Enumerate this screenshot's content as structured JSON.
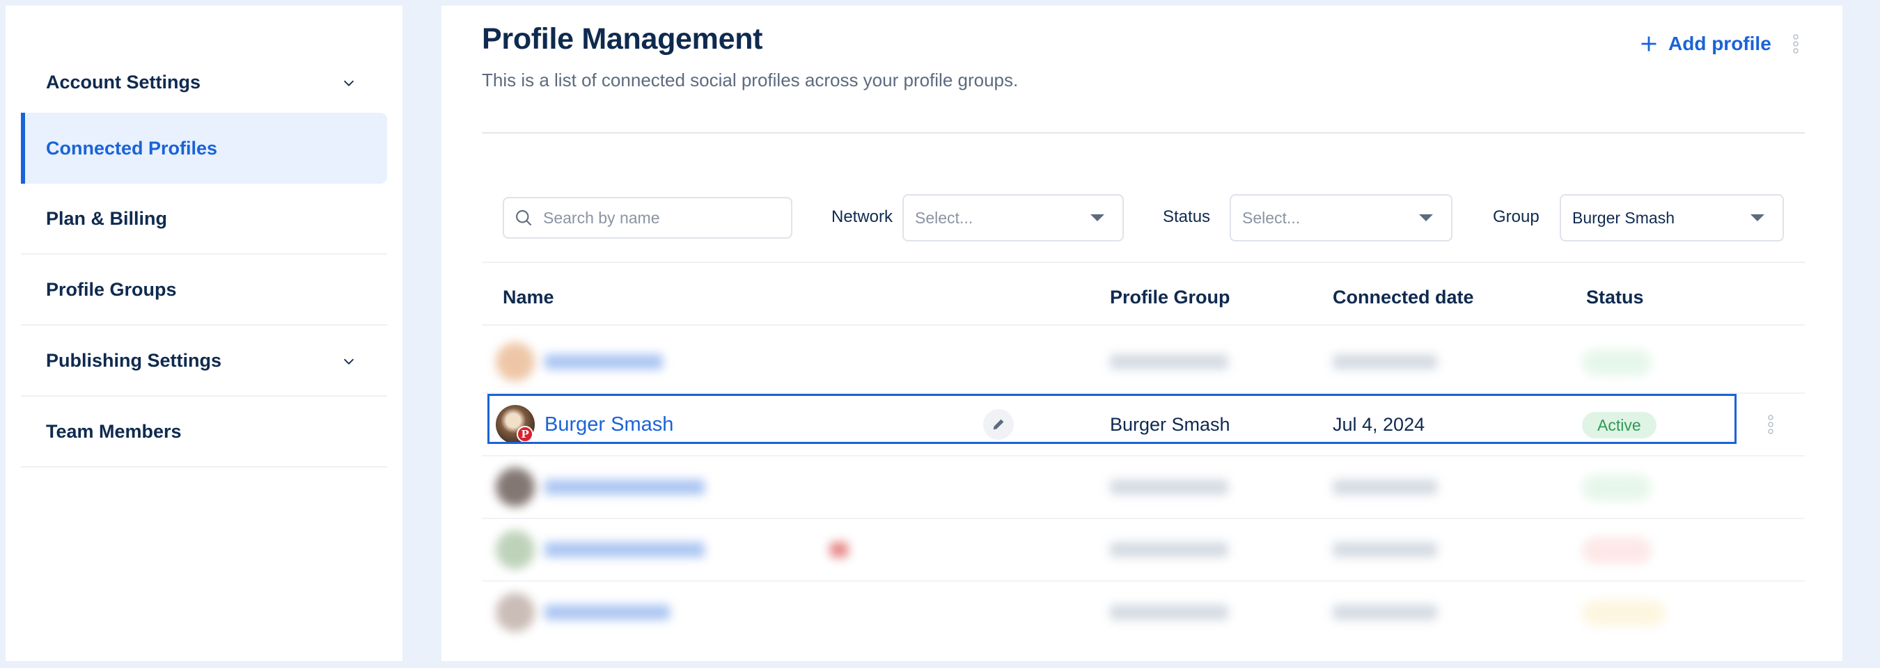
{
  "sidebar": {
    "items": [
      {
        "label": "Account Settings",
        "icon": "chevron-down-icon"
      },
      {
        "label": "Connected Profiles"
      },
      {
        "label": "Plan & Billing"
      },
      {
        "label": "Profile Groups"
      },
      {
        "label": "Publishing Settings",
        "icon": "chevron-down-icon"
      },
      {
        "label": "Team Members"
      }
    ],
    "active_index": 1
  },
  "header": {
    "title": "Profile Management",
    "subtitle": "This is a list of connected social profiles across your profile groups.",
    "add_button_label": "Add profile"
  },
  "filters": {
    "search_placeholder": "Search by name",
    "network_label": "Network",
    "network_placeholder": "Select...",
    "status_label": "Status",
    "status_placeholder": "Select...",
    "group_label": "Group",
    "group_value": "Burger Smash"
  },
  "table": {
    "columns": [
      "Name",
      "Profile Group",
      "Connected date",
      "Status"
    ],
    "highlighted_row": {
      "name": "Burger Smash",
      "network_badge": "P",
      "profile_group": "Burger Smash",
      "connected_date": "Jul 4, 2024",
      "status": "Active"
    }
  },
  "colors": {
    "accent": "#1a63d8",
    "active_bg": "#dff4e5",
    "active_text": "#2f9a55",
    "pinterest": "#d6232e"
  }
}
